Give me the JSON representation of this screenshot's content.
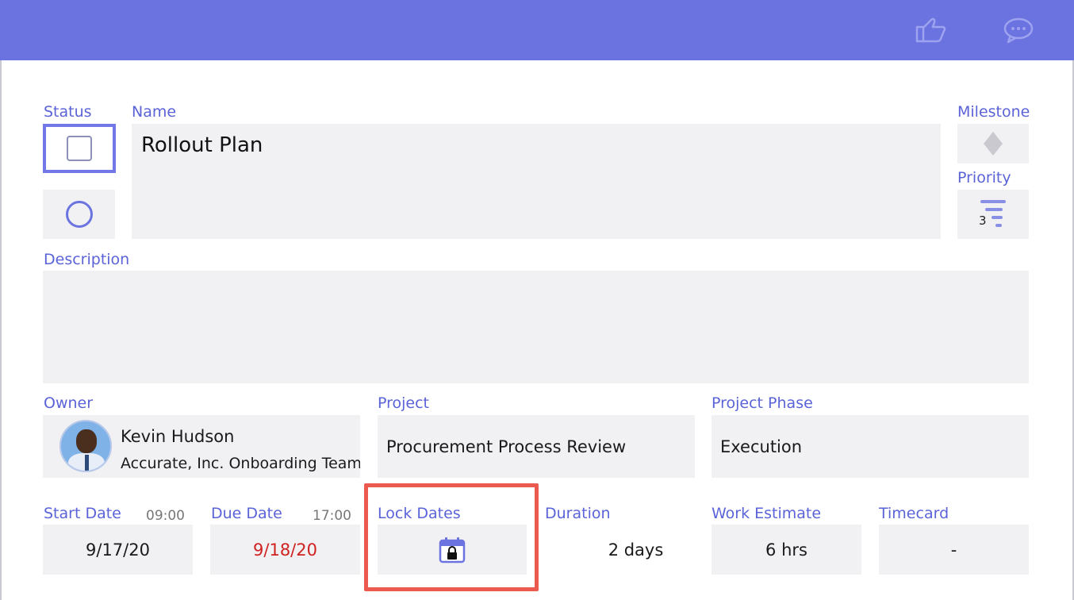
{
  "form": {
    "status_label": "Status",
    "name_label": "Name",
    "name_value": "Rollout Plan",
    "milestone_label": "Milestone",
    "priority_label": "Priority",
    "priority_value": "3",
    "description_label": "Description",
    "description_value": "",
    "owner_label": "Owner",
    "owner_name": "Kevin Hudson",
    "owner_team": "Accurate, Inc. Onboarding Team",
    "project_label": "Project",
    "project_value": "Procurement Process Review",
    "phase_label": "Project Phase",
    "phase_value": "Execution",
    "start_date_label": "Start Date",
    "start_time": "09:00",
    "start_date_value": "9/17/20",
    "due_date_label": "Due Date",
    "due_time": "17:00",
    "due_date_value": "9/18/20",
    "lock_dates_label": "Lock Dates",
    "duration_label": "Duration",
    "duration_value": "2 days",
    "work_estimate_label": "Work Estimate",
    "work_estimate_value": "6 hrs",
    "timecard_label": "Timecard",
    "timecard_value": "-"
  },
  "icons": {
    "like": "thumbs-up-icon",
    "comment": "chat-bubble-icon",
    "milestone": "diamond-icon",
    "priority": "priority-filter-icon",
    "lock": "calendar-lock-icon"
  },
  "colors": {
    "header": "#6b73e0",
    "label": "#5a63d8",
    "overdue": "#d02121",
    "highlight": "#ec5a4f"
  }
}
